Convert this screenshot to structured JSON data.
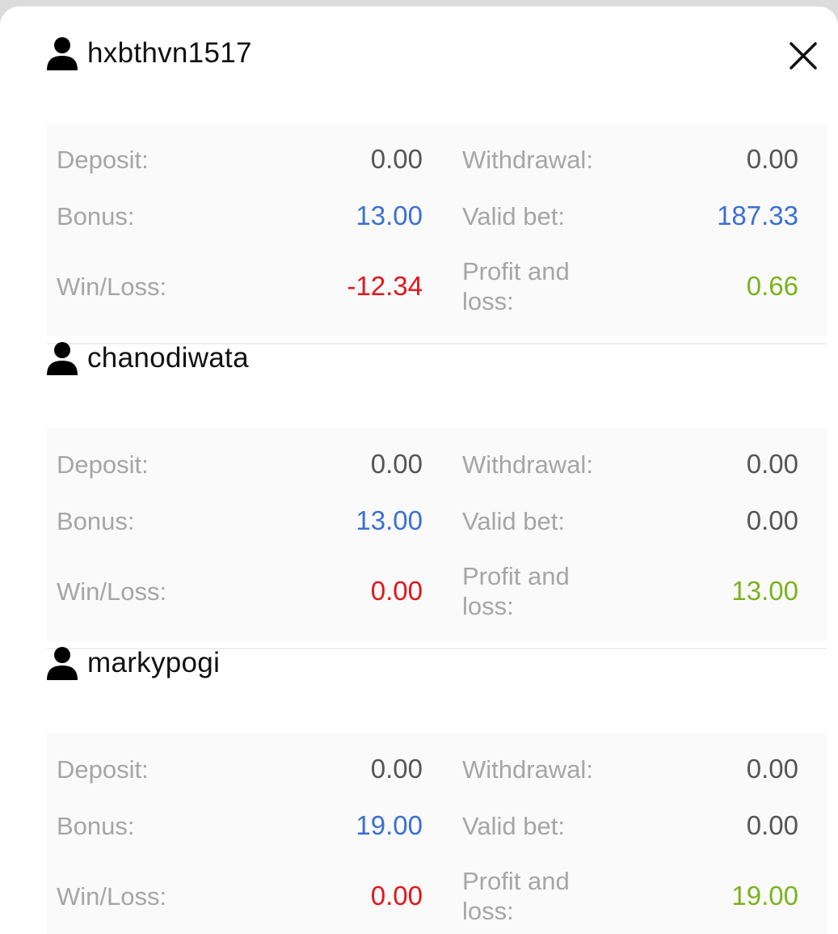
{
  "colors": {
    "neutral": "#555555",
    "blue": "#3b6fd6",
    "red": "#e3161b",
    "green": "#7bb21e",
    "label": "#a6a6a6"
  },
  "icons": {
    "user": "user-icon",
    "close": "close-icon"
  },
  "labels": {
    "deposit": "Deposit:",
    "withdrawal": "Withdrawal:",
    "bonus": "Bonus:",
    "valid_bet": "Valid bet:",
    "win_loss": "Win/Loss:",
    "profit_loss": "Profit and loss:"
  },
  "users": [
    {
      "name": "hxbthvn1517",
      "deposit": "0.00",
      "withdrawal": "0.00",
      "bonus": "13.00",
      "valid_bet": "187.33",
      "win_loss": "-12.34",
      "profit_loss": "0.66"
    },
    {
      "name": "chanodiwata",
      "deposit": "0.00",
      "withdrawal": "0.00",
      "bonus": "13.00",
      "valid_bet": "0.00",
      "win_loss": "0.00",
      "profit_loss": "13.00"
    },
    {
      "name": "markypogi",
      "deposit": "0.00",
      "withdrawal": "0.00",
      "bonus": "19.00",
      "valid_bet": "0.00",
      "win_loss": "0.00",
      "profit_loss": "19.00"
    }
  ]
}
